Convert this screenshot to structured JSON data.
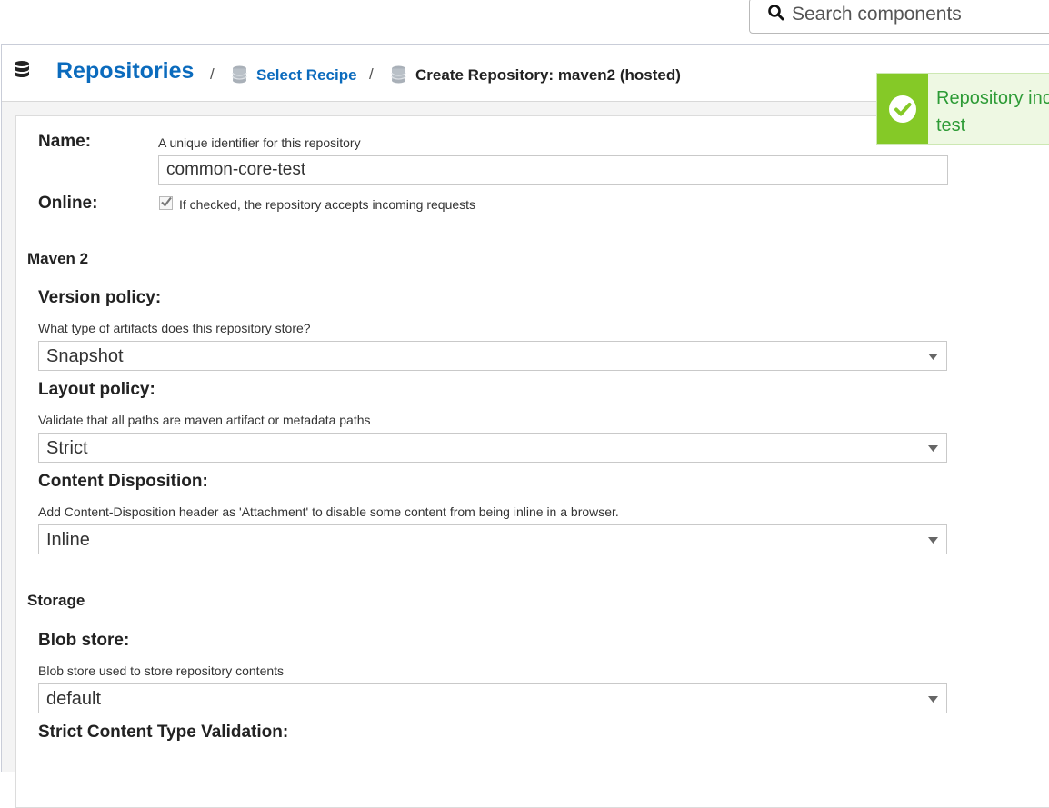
{
  "search": {
    "placeholder": "Search components"
  },
  "breadcrumb": {
    "root": "Repositories",
    "separator": "/",
    "select_recipe": "Select Recipe",
    "current": "Create Repository: maven2 (hosted)"
  },
  "form": {
    "name": {
      "label": "Name:",
      "help": "A unique identifier for this repository",
      "value": "common-core-test"
    },
    "online": {
      "label": "Online:",
      "help": "If checked, the repository accepts incoming requests",
      "checked": true
    },
    "maven": {
      "section": "Maven 2",
      "version_policy": {
        "label": "Version policy:",
        "help": "What type of artifacts does this repository store?",
        "value": "Snapshot"
      },
      "layout_policy": {
        "label": "Layout policy:",
        "help": "Validate that all paths are maven artifact or metadata paths",
        "value": "Strict"
      },
      "content_disposition": {
        "label": "Content Disposition:",
        "help": "Add Content-Disposition header as 'Attachment' to disable some content from being inline in a browser.",
        "value": "Inline"
      }
    },
    "storage": {
      "section": "Storage",
      "blob_store": {
        "label": "Blob store:",
        "help": "Blob store used to store repository contents",
        "value": "default"
      },
      "strict_content": {
        "label": "Strict Content Type Validation:"
      }
    }
  },
  "toast": {
    "line1": "Repository inc",
    "line2": "test"
  },
  "colors": {
    "link": "#0b6bbd",
    "toast_green": "#85c927",
    "toast_text": "#2d9b36"
  },
  "icons": [
    "search-icon",
    "database-icon",
    "database-crumb-icon",
    "caret-down-icon",
    "check-circle-icon",
    "checkbox-check-icon"
  ]
}
